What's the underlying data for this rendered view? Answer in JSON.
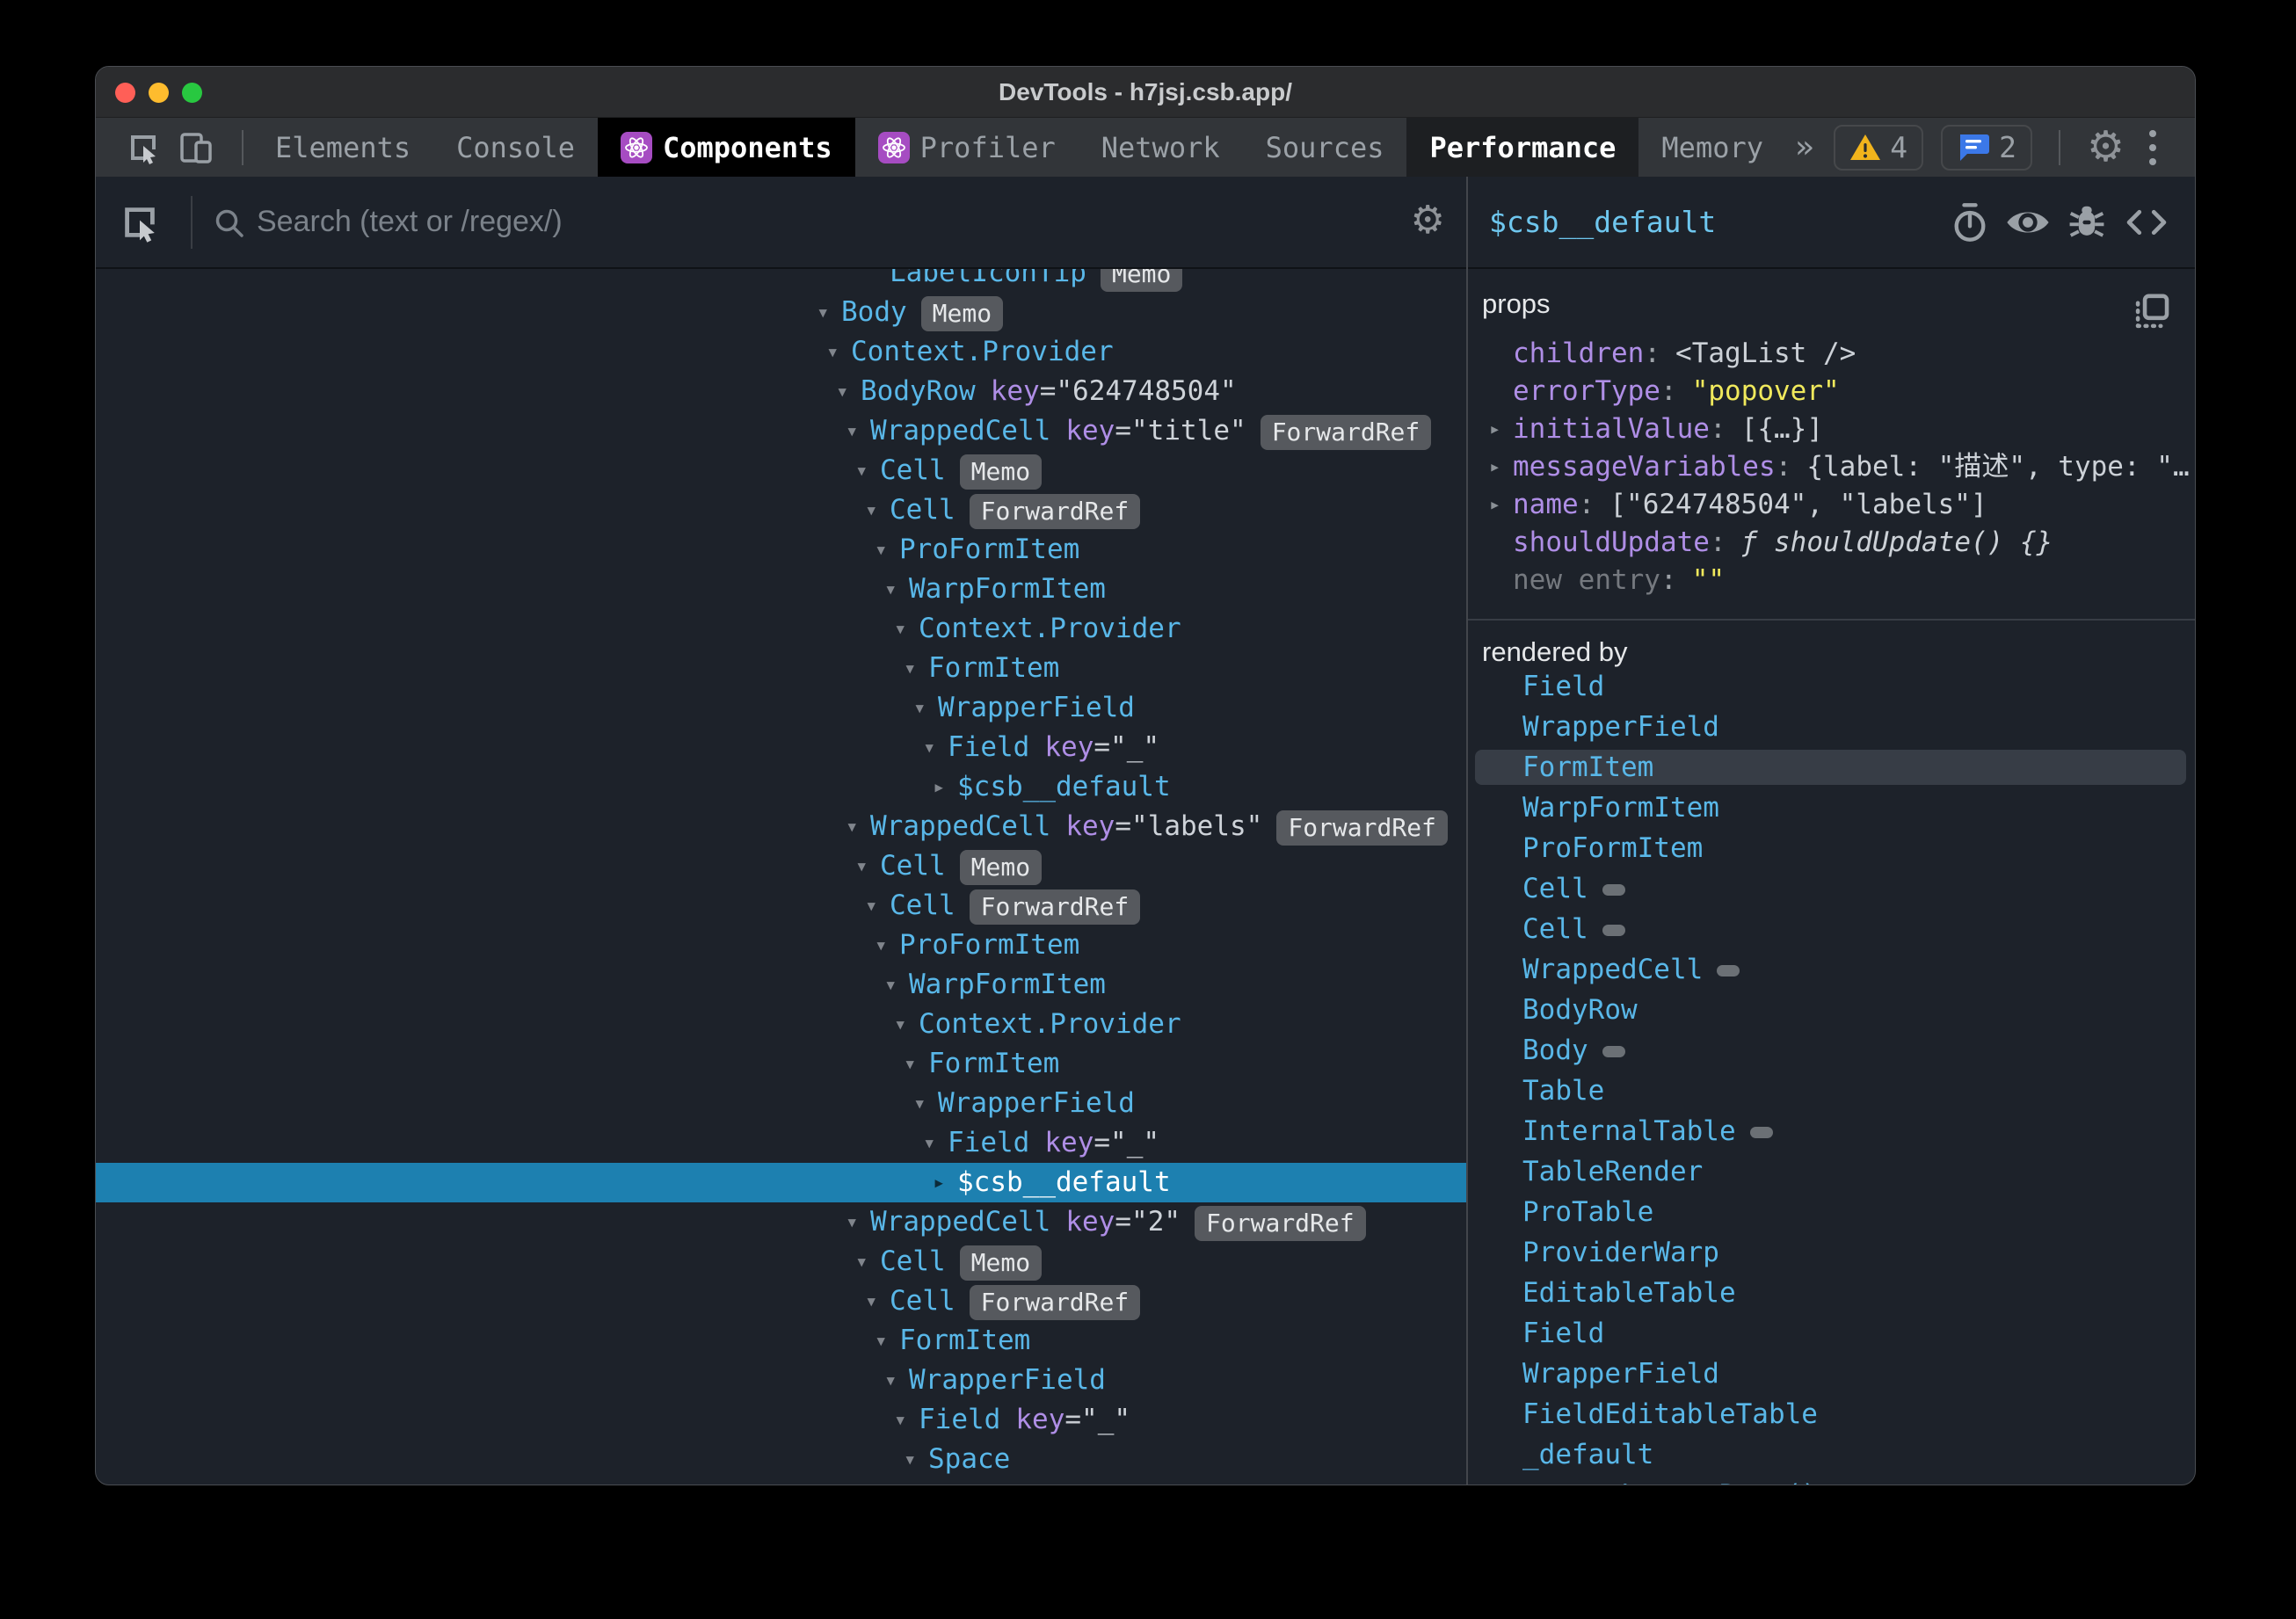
{
  "window": {
    "title": "DevTools - h7jsj.csb.app/"
  },
  "tabs": {
    "items": [
      {
        "label": "Elements",
        "icon": null,
        "state": "normal"
      },
      {
        "label": "Console",
        "icon": null,
        "state": "normal"
      },
      {
        "label": "Components",
        "icon": "react",
        "state": "active-black"
      },
      {
        "label": "Profiler",
        "icon": "react",
        "state": "normal"
      },
      {
        "label": "Network",
        "icon": null,
        "state": "normal"
      },
      {
        "label": "Sources",
        "icon": null,
        "state": "normal"
      },
      {
        "label": "Performance",
        "icon": null,
        "state": "active-dark"
      },
      {
        "label": "Memory",
        "icon": null,
        "state": "normal"
      }
    ],
    "overflow_chevron": "»",
    "badges": [
      {
        "type": "warning",
        "count": "4"
      },
      {
        "type": "message",
        "count": "2"
      }
    ]
  },
  "search": {
    "placeholder": "Search (text or /regex/)"
  },
  "tree": {
    "rows": [
      {
        "indent": 5,
        "expander": null,
        "name": "LabelIconTip",
        "key": null,
        "badge": "Memo",
        "selected": false
      },
      {
        "indent": 0,
        "expander": "open",
        "name": "Body",
        "key": null,
        "badge": "Memo",
        "selected": false
      },
      {
        "indent": 1,
        "expander": "open",
        "name": "Context.Provider",
        "key": null,
        "badge": null,
        "selected": false
      },
      {
        "indent": 2,
        "expander": "open",
        "name": "BodyRow",
        "key": "624748504",
        "badge": null,
        "selected": false
      },
      {
        "indent": 3,
        "expander": "open",
        "name": "WrappedCell",
        "key": "title",
        "badge": "ForwardRef",
        "selected": false
      },
      {
        "indent": 4,
        "expander": "open",
        "name": "Cell",
        "key": null,
        "badge": "Memo",
        "selected": false
      },
      {
        "indent": 5,
        "expander": "open",
        "name": "Cell",
        "key": null,
        "badge": "ForwardRef",
        "selected": false
      },
      {
        "indent": 6,
        "expander": "open",
        "name": "ProFormItem",
        "key": null,
        "badge": null,
        "selected": false
      },
      {
        "indent": 7,
        "expander": "open",
        "name": "WarpFormItem",
        "key": null,
        "badge": null,
        "selected": false
      },
      {
        "indent": 8,
        "expander": "open",
        "name": "Context.Provider",
        "key": null,
        "badge": null,
        "selected": false
      },
      {
        "indent": 9,
        "expander": "open",
        "name": "FormItem",
        "key": null,
        "badge": null,
        "selected": false
      },
      {
        "indent": 10,
        "expander": "open",
        "name": "WrapperField",
        "key": null,
        "badge": null,
        "selected": false
      },
      {
        "indent": 11,
        "expander": "open",
        "name": "Field",
        "key": "_",
        "badge": null,
        "selected": false
      },
      {
        "indent": 12,
        "expander": "collapsed",
        "name": "$csb__default",
        "key": null,
        "badge": null,
        "selected": false
      },
      {
        "indent": 3,
        "expander": "open",
        "name": "WrappedCell",
        "key": "labels",
        "badge": "ForwardRef",
        "selected": false
      },
      {
        "indent": 4,
        "expander": "open",
        "name": "Cell",
        "key": null,
        "badge": "Memo",
        "selected": false
      },
      {
        "indent": 5,
        "expander": "open",
        "name": "Cell",
        "key": null,
        "badge": "ForwardRef",
        "selected": false
      },
      {
        "indent": 6,
        "expander": "open",
        "name": "ProFormItem",
        "key": null,
        "badge": null,
        "selected": false
      },
      {
        "indent": 7,
        "expander": "open",
        "name": "WarpFormItem",
        "key": null,
        "badge": null,
        "selected": false
      },
      {
        "indent": 8,
        "expander": "open",
        "name": "Context.Provider",
        "key": null,
        "badge": null,
        "selected": false
      },
      {
        "indent": 9,
        "expander": "open",
        "name": "FormItem",
        "key": null,
        "badge": null,
        "selected": false
      },
      {
        "indent": 10,
        "expander": "open",
        "name": "WrapperField",
        "key": null,
        "badge": null,
        "selected": false
      },
      {
        "indent": 11,
        "expander": "open",
        "name": "Field",
        "key": "_",
        "badge": null,
        "selected": false
      },
      {
        "indent": 12,
        "expander": "collapsed",
        "name": "$csb__default",
        "key": null,
        "badge": null,
        "selected": true
      },
      {
        "indent": 3,
        "expander": "open",
        "name": "WrappedCell",
        "key": "2",
        "badge": "ForwardRef",
        "selected": false
      },
      {
        "indent": 4,
        "expander": "open",
        "name": "Cell",
        "key": null,
        "badge": "Memo",
        "selected": false
      },
      {
        "indent": 5,
        "expander": "open",
        "name": "Cell",
        "key": null,
        "badge": "ForwardRef",
        "selected": false
      },
      {
        "indent": 6,
        "expander": "open",
        "name": "FormItem",
        "key": null,
        "badge": null,
        "selected": false
      },
      {
        "indent": 7,
        "expander": "open",
        "name": "WrapperField",
        "key": null,
        "badge": null,
        "selected": false
      },
      {
        "indent": 8,
        "expander": "open",
        "name": "Field",
        "key": "_",
        "badge": null,
        "selected": false
      },
      {
        "indent": 9,
        "expander": "open",
        "name": "Space",
        "key": null,
        "badge": null,
        "selected": false
      }
    ]
  },
  "inspector": {
    "title": "$csb__default",
    "props_header": "props",
    "props": [
      {
        "key": "children",
        "value": "<TagList />",
        "expandable": false,
        "value_color": "default",
        "func": false,
        "dim": false
      },
      {
        "key": "errorType",
        "value": "\"popover\"",
        "expandable": false,
        "value_color": "yellow",
        "func": false,
        "dim": false
      },
      {
        "key": "initialValue",
        "value": "[{…}]",
        "expandable": true,
        "value_color": "default",
        "func": false,
        "dim": false
      },
      {
        "key": "messageVariables",
        "value": "{label: \"描述\", type: \"…",
        "expandable": true,
        "value_color": "default",
        "func": false,
        "dim": false
      },
      {
        "key": "name",
        "value": "[\"624748504\", \"labels\"]",
        "expandable": true,
        "value_color": "default",
        "func": false,
        "dim": false
      },
      {
        "key": "shouldUpdate",
        "value": "ƒ shouldUpdate() {}",
        "expandable": false,
        "value_color": "default",
        "func": true,
        "dim": false
      },
      {
        "key": "new entry",
        "value": "\"\"",
        "expandable": false,
        "value_color": "yellow",
        "func": false,
        "dim": true
      }
    ],
    "rendered_by_header": "rendered by",
    "rendered_by": [
      {
        "label": "Field",
        "badge": false,
        "highlighted": false
      },
      {
        "label": "WrapperField",
        "badge": false,
        "highlighted": false
      },
      {
        "label": "FormItem",
        "badge": false,
        "highlighted": true
      },
      {
        "label": "WarpFormItem",
        "badge": false,
        "highlighted": false
      },
      {
        "label": "ProFormItem",
        "badge": false,
        "highlighted": false
      },
      {
        "label": "Cell",
        "badge": true,
        "highlighted": false
      },
      {
        "label": "Cell",
        "badge": true,
        "highlighted": false
      },
      {
        "label": "WrappedCell",
        "badge": true,
        "highlighted": false
      },
      {
        "label": "BodyRow",
        "badge": false,
        "highlighted": false
      },
      {
        "label": "Body",
        "badge": true,
        "highlighted": false
      },
      {
        "label": "Table",
        "badge": false,
        "highlighted": false
      },
      {
        "label": "InternalTable",
        "badge": true,
        "highlighted": false
      },
      {
        "label": "TableRender",
        "badge": false,
        "highlighted": false
      },
      {
        "label": "ProTable",
        "badge": false,
        "highlighted": false
      },
      {
        "label": "ProviderWarp",
        "badge": false,
        "highlighted": false
      },
      {
        "label": "EditableTable",
        "badge": false,
        "highlighted": false
      },
      {
        "label": "Field",
        "badge": false,
        "highlighted": false
      },
      {
        "label": "WrapperField",
        "badge": false,
        "highlighted": false
      },
      {
        "label": "FieldEditableTable",
        "badge": false,
        "highlighted": false
      },
      {
        "label": "_default",
        "badge": false,
        "highlighted": false
      },
      {
        "label": "createLegacyRoot()",
        "badge": false,
        "highlighted": false
      }
    ]
  },
  "colors": {
    "selection_blue": "#1d80b0",
    "component_cyan": "#59b7e8",
    "key_purple": "#af8ee6",
    "string_yellow": "#f0e95c",
    "react_purple": "#a64cc2",
    "warning_yellow": "#f2b41c",
    "message_blue": "#3b78e8",
    "traffic_red": "#ff5f57",
    "traffic_yellow": "#febc2e",
    "traffic_green": "#28c840"
  }
}
